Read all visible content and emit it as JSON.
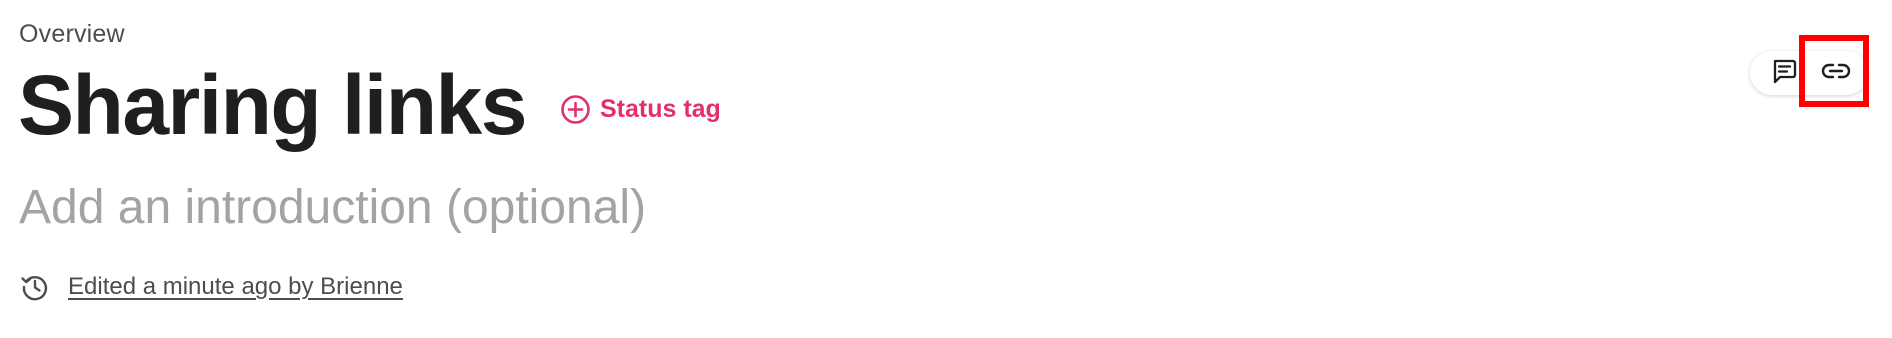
{
  "header": {
    "breadcrumb": "Overview",
    "title": "Sharing links",
    "status_tag_label": "Status tag",
    "status_tag_icon": "plus-circle-icon"
  },
  "intro": {
    "placeholder": "Add an introduction (optional)"
  },
  "history": {
    "icon": "history-icon",
    "text": "Edited a minute ago by Brienne"
  },
  "actions": {
    "comment_icon": "comment-icon",
    "link_icon": "link-icon",
    "highlighted": "link-button"
  },
  "colors": {
    "accent": "#e3306b",
    "title": "#1f1f1f",
    "muted": "#a3a3a3",
    "secondary_text": "#4d4d4d",
    "highlight": "#ff0000"
  }
}
